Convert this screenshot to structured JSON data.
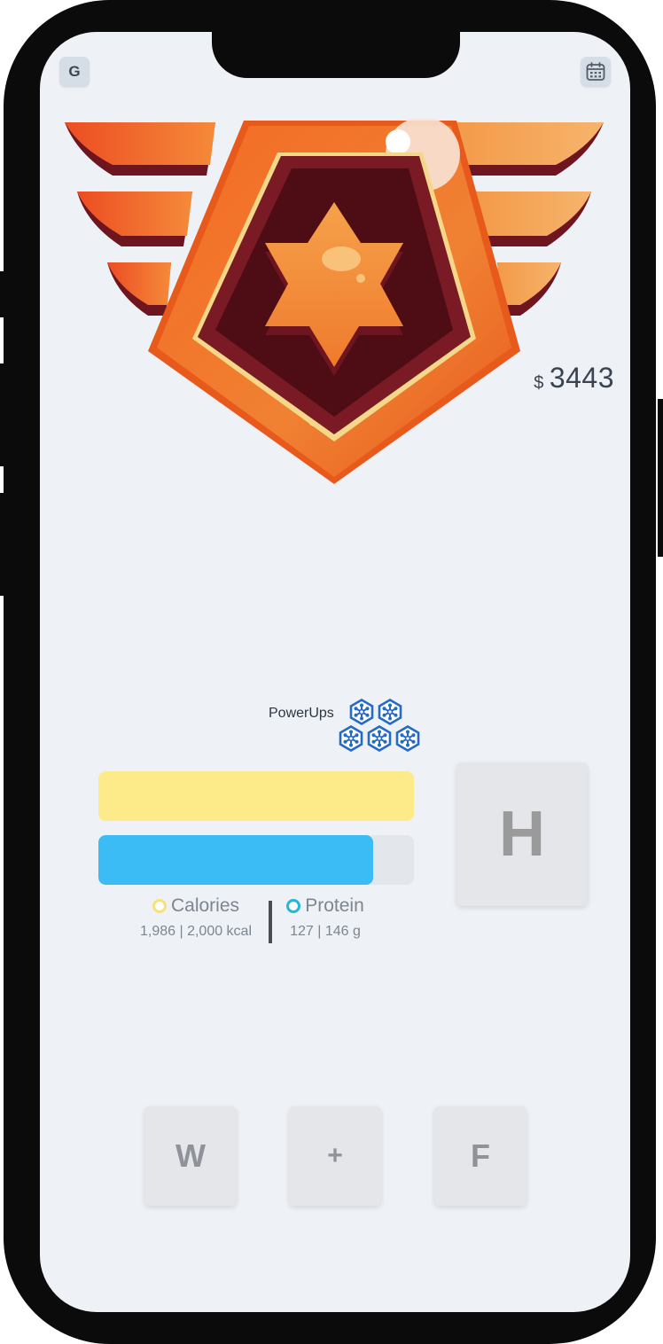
{
  "top_bar": {
    "left_button_label": "G",
    "right_button_icon": "calendar-icon"
  },
  "rank_badge": {
    "icon": "winged-star-badge",
    "colors": {
      "orange": "#f0702a",
      "dark_red": "#5e1018",
      "gold": "#f3d889"
    }
  },
  "balance": {
    "currency": "$",
    "amount": "3443"
  },
  "powerups": {
    "label": "PowerUps",
    "count": 5,
    "icon": "snowflake-hex-icon",
    "color": "#2569c9"
  },
  "progress": {
    "calories": {
      "label": "Calories",
      "value_text": "1,986 | 2,000 kcal",
      "fill_fraction": 1.0,
      "color": "#fdeb8a"
    },
    "protein": {
      "label": "Protein",
      "value_text": "127 | 146 g",
      "fill_fraction": 0.87,
      "color": "#3bbcf5"
    }
  },
  "h_button_label": "H",
  "bottom_nav": {
    "w_label": "W",
    "add_label": "+",
    "f_label": "F"
  }
}
